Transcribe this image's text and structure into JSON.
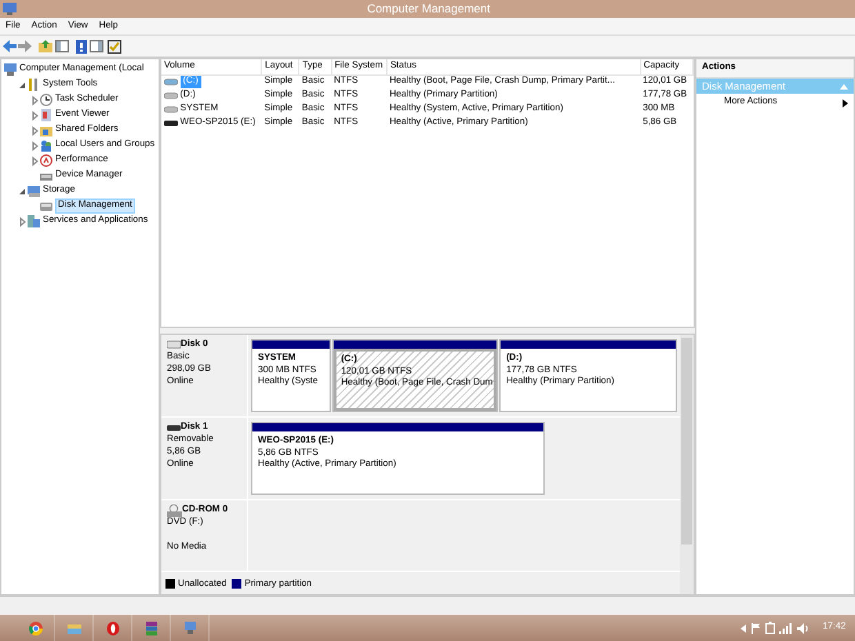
{
  "window": {
    "title": "Computer Management"
  },
  "menu": [
    "File",
    "Action",
    "View",
    "Help"
  ],
  "tree": [
    {
      "label": "Computer Management (Local",
      "selected": false,
      "children": [
        {
          "label": "System Tools",
          "expanded": true,
          "selected": false,
          "children": [
            {
              "label": "Task Scheduler",
              "expanded": false,
              "selected": false
            },
            {
              "label": "Event Viewer",
              "expanded": false,
              "selected": false
            },
            {
              "label": "Shared Folders",
              "expanded": false,
              "selected": false
            },
            {
              "label": "Local Users and Groups",
              "expanded": false,
              "selected": false
            },
            {
              "label": "Performance",
              "expanded": false,
              "selected": false
            },
            {
              "label": "Device Manager",
              "selected": false
            }
          ]
        },
        {
          "label": "Storage",
          "expanded": true,
          "selected": false,
          "children": [
            {
              "label": "Disk Management",
              "selected": true
            }
          ]
        },
        {
          "label": "Services and Applications",
          "expanded": false,
          "selected": false
        }
      ]
    }
  ],
  "volumes": {
    "columns": [
      "Volume",
      "Layout",
      "Type",
      "File System",
      "Status",
      "Capacity"
    ],
    "rows": [
      {
        "kind": "disk",
        "selected": true,
        "cells": [
          "(C:)",
          "Simple",
          "Basic",
          "NTFS",
          "Healthy (Boot, Page File, Crash Dump, Primary Partit...",
          "120,01 GB"
        ]
      },
      {
        "kind": "disk",
        "selected": false,
        "cells": [
          "(D:)",
          "Simple",
          "Basic",
          "NTFS",
          "Healthy (Primary Partition)",
          "177,78 GB"
        ]
      },
      {
        "kind": "disk",
        "selected": false,
        "cells": [
          "SYSTEM",
          "Simple",
          "Basic",
          "NTFS",
          "Healthy (System, Active, Primary Partition)",
          "300 MB"
        ]
      },
      {
        "kind": "removable",
        "selected": false,
        "cells": [
          "WEO-SP2015 (E:)",
          "Simple",
          "Basic",
          "NTFS",
          "Healthy (Active, Primary Partition)",
          "5,86 GB"
        ]
      }
    ]
  },
  "disks": [
    {
      "kind": "hdd",
      "name": "Disk 0",
      "lines": [
        "Basic",
        "298,09 GB",
        "Online"
      ],
      "partitions": [
        {
          "name": "SYSTEM",
          "size": "300 MB NTFS",
          "status": "Healthy (Syste",
          "selected": false
        },
        {
          "name": "(C:)",
          "size": "120,01 GB NTFS",
          "status": "Healthy (Boot, Page File, Crash Dum",
          "selected": true
        },
        {
          "name": "(D:)",
          "size": "177,78 GB NTFS",
          "status": "Healthy (Primary Partition)",
          "selected": false
        }
      ]
    },
    {
      "kind": "removable",
      "name": "Disk 1",
      "lines": [
        "Removable",
        "5,86 GB",
        "Online"
      ],
      "partitions": [
        {
          "name": "WEO-SP2015  (E:)",
          "size": "5,86 GB NTFS",
          "status": "Healthy (Active, Primary Partition)",
          "selected": false
        }
      ]
    },
    {
      "kind": "cdrom",
      "name": "CD-ROM 0",
      "lines": [
        "DVD (F:)",
        "No Media"
      ]
    }
  ],
  "legend": [
    {
      "label": "Unallocated",
      "color": "#000000"
    },
    {
      "label": "Primary partition",
      "color": "#000080"
    }
  ],
  "actions": {
    "header": "Actions",
    "section": {
      "label": "Disk Management",
      "expanded": true,
      "items": [
        "More Actions"
      ]
    }
  },
  "taskbar": {
    "clock": "17:42"
  }
}
